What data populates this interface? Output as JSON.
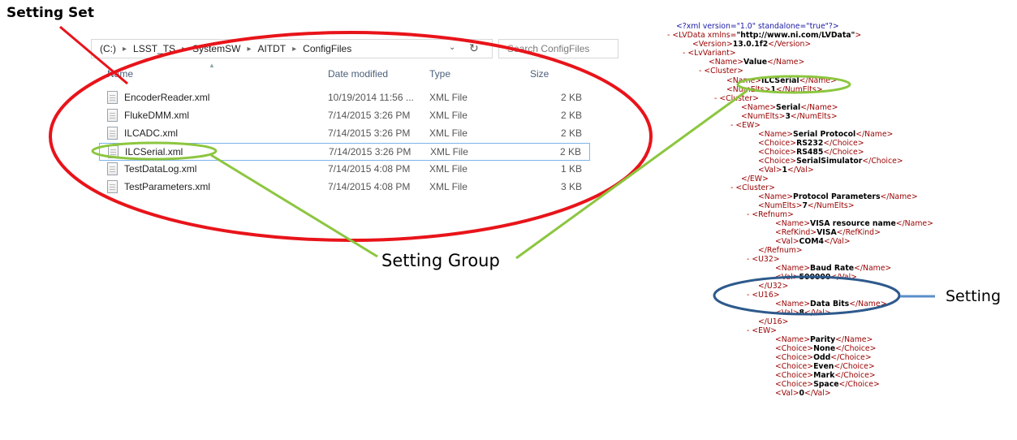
{
  "annotations": {
    "setting_set": "Setting Set",
    "setting_group": "Setting Group",
    "setting": "Setting"
  },
  "explorer": {
    "breadcrumb": [
      "(C:)",
      "LSST_TS",
      "SystemSW",
      "AITDT",
      "ConfigFiles"
    ],
    "search_placeholder": "Search ConfigFiles",
    "columns": {
      "name": "Name",
      "date": "Date modified",
      "type": "Type",
      "size": "Size"
    },
    "files": [
      {
        "name": "EncoderReader.xml",
        "date": "10/19/2014 11:56 ...",
        "type": "XML File",
        "size": "2 KB"
      },
      {
        "name": "FlukeDMM.xml",
        "date": "7/14/2015 3:26 PM",
        "type": "XML File",
        "size": "2 KB"
      },
      {
        "name": "ILCADC.xml",
        "date": "7/14/2015 3:26 PM",
        "type": "XML File",
        "size": "2 KB"
      },
      {
        "name": "ILCSerial.xml",
        "date": "7/14/2015 3:26 PM",
        "type": "XML File",
        "size": "2 KB"
      },
      {
        "name": "TestDataLog.xml",
        "date": "7/14/2015 4:08 PM",
        "type": "XML File",
        "size": "1 KB"
      },
      {
        "name": "TestParameters.xml",
        "date": "7/14/2015 4:08 PM",
        "type": "XML File",
        "size": "3 KB"
      }
    ]
  },
  "xml": {
    "decl": "<?xml version=\"1.0\" standalone=\"true\"?>",
    "root_open": "<LVData xmlns=",
    "root_ns": "\"http://www.ni.com/LVData\"",
    "version": "13.0.1f2",
    "variant_name": "Value",
    "cluster1_name": "ILCSerial",
    "cluster1_numelts": "1",
    "cluster2_name": "Serial",
    "cluster2_numelts": "3",
    "ew1_name": "Serial Protocol",
    "ew1_choices": [
      "RS232",
      "RS485",
      "SerialSimulator"
    ],
    "ew1_val": "1",
    "cluster3_name": "Protocol Parameters",
    "cluster3_numelts": "7",
    "refnum_name": "VISA resource name",
    "refnum_kind": "VISA",
    "refnum_val": "COM4",
    "u32_name": "Baud Rate",
    "u32_val": "500000",
    "u16_name": "Data Bits",
    "u16_val": "8",
    "ew2_name": "Parity",
    "ew2_choices": [
      "None",
      "Odd",
      "Even",
      "Mark",
      "Space"
    ],
    "ew2_val": "0"
  },
  "colors": {
    "setting_set_ellipse": "#e8141a",
    "setting_group_ellipse": "#8cc63f",
    "setting_ellipse": "#2e5a8c"
  }
}
